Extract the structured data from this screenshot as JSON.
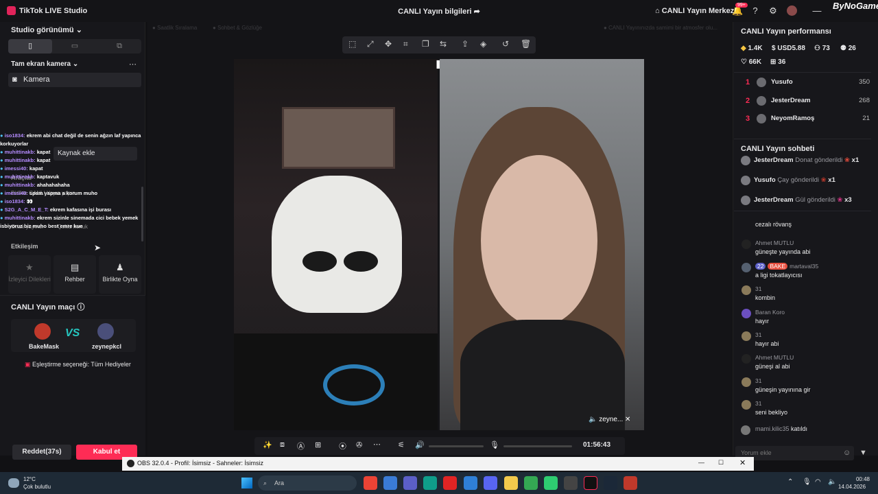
{
  "app": {
    "title": "TikTok LIVE Studio",
    "center_title": "CANLI Yayın bilgileri",
    "center_right": "CANLI Yayın Merkezi",
    "notif": "99+",
    "brand": "ByNoGame"
  },
  "left": {
    "studio_view": "Studio görünümü",
    "camera_section": "Tam ekran kamera",
    "camera_item": "Kamera",
    "kaynak": "Kaynak ekle",
    "ghost": [
      "Araçlar",
      "Birlikte CANLI Yayın yapın",
      "Ortak yayıncı",
      "Çoklu konuk"
    ],
    "interaction": "Etkileşim",
    "cards": [
      {
        "label": "İzleyici Dilekleri",
        "icon": "★"
      },
      {
        "label": "Rehber",
        "icon": "▤"
      },
      {
        "label": "Birlikte Oyna",
        "icon": "♟"
      }
    ],
    "cards2": [
      {
        "icon": "◎"
      },
      {
        "icon": "☑"
      },
      {
        "icon": "▣"
      }
    ],
    "match_title": "CANLI Yayın maçı",
    "p1": "BakeMask",
    "p2": "zeynepkcl",
    "vs": "VS",
    "pairing": "Eşleştirme seçeneği: Tüm Hediyeler",
    "reject": "Reddet(37s)",
    "accept": "Kabul et"
  },
  "chat_overlay": [
    {
      "u": "iso1834:",
      "t": "ekrem abi chat değil de senin ağzın laf yapınca korkuyorlar"
    },
    {
      "u": "muhittinakb:",
      "t": "kapat"
    },
    {
      "u": "muhittinakb:",
      "t": "kapat"
    },
    {
      "u": "imessi40:",
      "t": "kapat"
    },
    {
      "u": "muhittinakb:",
      "t": "kaptavuk"
    },
    {
      "u": "muhittinakb:",
      "t": "ahahahahaha"
    },
    {
      "u": "imessi40:",
      "t": "spam yapma a korum muho"
    },
    {
      "u": "iso1834:",
      "t": "👀"
    },
    {
      "u": "S2G_A_C_M_E_T:",
      "t": "ekrem kafasına işi burası"
    },
    {
      "u": "muhittinakb:",
      "t": "ekrem sizinle sinemada cici bebek yemek isbiyoruz biz muho best emre kue"
    }
  ],
  "stage": {
    "top_hints": [
      "Saatlik Sıralama",
      "Sohbet & Gözlüğe",
      "CANLI Yayınınızda samimi bir atmosfer olu..."
    ],
    "guest_name": "zeyne...",
    "timer": "01:56:43"
  },
  "right": {
    "perf_title": "CANLI Yayın performansı",
    "stats": [
      "1.4K",
      "USD5.88",
      "73",
      "26",
      "66K",
      "36"
    ],
    "ranking": [
      {
        "n": "1",
        "name": "Yusufo",
        "v": "350"
      },
      {
        "n": "2",
        "name": "JesterDream",
        "v": "268"
      },
      {
        "n": "3",
        "name": "NeyomRamoş",
        "v": "21"
      }
    ],
    "chat_title": "CANLI Yayın sohbeti",
    "gifts": [
      {
        "name": "JesterDream",
        "action": "Donat gönderildi",
        "count": "x1"
      },
      {
        "name": "Yusufo",
        "action": "Çay gönderildi",
        "count": "x1"
      },
      {
        "name": "JesterDream",
        "action": "Gül gönderildi",
        "count": "x3"
      }
    ],
    "messages": [
      {
        "name": "",
        "text": "cezalı rövanş"
      },
      {
        "name": "Ahmet MUTLU",
        "text": "güneşte yayında abi"
      },
      {
        "name": "martaval35",
        "badge1": "22",
        "badge2": "BAKE",
        "text": "a ligi tokatlayıcısı"
      },
      {
        "name": "31",
        "text": "kombin"
      },
      {
        "name": "Baran Koro",
        "text": "hayır"
      },
      {
        "name": "31",
        "text": "hayır abi"
      },
      {
        "name": "Ahmet MUTLU",
        "text": "güneşi al abi"
      },
      {
        "name": "31",
        "text": "güneşin yayınına gir"
      },
      {
        "name": "31",
        "text": "seni bekliyo"
      }
    ],
    "joined_name": "mami.kilic35",
    "joined": "katıldı",
    "comment_placeholder": "Yorum ekle"
  },
  "obs": {
    "title": "OBS 32.0.4 - Profil: İsimsiz - Sahneler: İsimsiz"
  },
  "taskbar": {
    "temp": "12°C",
    "weather": "Çok bulutlu",
    "search": "Ara",
    "time": "00:48",
    "date": "14.04.2026"
  }
}
